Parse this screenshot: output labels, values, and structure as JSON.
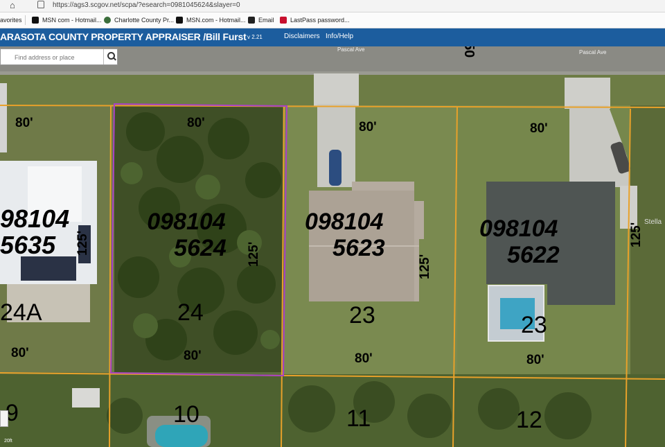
{
  "browser": {
    "url": "https://ags3.scgov.net/scpa/?esearch=0981045624&slayer=0",
    "bookmarks": [
      "avorites",
      "MSN com - Hotmail...",
      "Charlotte County Pr...",
      "MSN.com - Hotmail...",
      "Email",
      "LastPass password..."
    ]
  },
  "app": {
    "title": "ARASOTA COUNTY PROPERTY APPRAISER /Bill Furst",
    "version": "v 2.21",
    "links": [
      "Disclaimers",
      "Info/Help"
    ]
  },
  "search": {
    "placeholder": "Find address or place"
  },
  "map": {
    "streets": [
      "Pascal Ave",
      "Pascal Ave"
    ],
    "street_number": "50",
    "parcels": [
      {
        "id_line1": "98104",
        "id_line2": "5635",
        "lot": "24A",
        "frontage": "80'",
        "depth": "125'"
      },
      {
        "id_line1": "098104",
        "id_line2": "5624",
        "lot": "24",
        "frontage_top": "80'",
        "frontage_bottom": "80'",
        "depth": "125'",
        "selected": true
      },
      {
        "id_line1": "098104",
        "id_line2": "5623",
        "lot": "23",
        "frontage_top": "80'",
        "frontage_bottom": "80'",
        "depth": "125'"
      },
      {
        "id_line1": "098104",
        "id_line2": "5622",
        "lot": "23",
        "frontage_top": "80'",
        "frontage_bottom": "80'",
        "depth": "125'"
      }
    ],
    "left_frontage_top": "80'",
    "right_depth": "125'",
    "south_lots": [
      "9",
      "10",
      "11",
      "12"
    ],
    "edge_label": "Stella",
    "scale_label": "20ft",
    "colors": {
      "parcel_line": "#e8a12a",
      "selected": "#a940c8",
      "header": "#1c5d9e"
    }
  }
}
